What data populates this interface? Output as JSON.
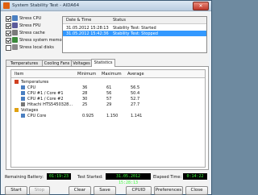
{
  "window": {
    "title": "System Stability Test - AIDA64",
    "close_glyph": "✕"
  },
  "stress": [
    {
      "label": "Stress CPU",
      "checked": true,
      "icon": "cpu-icon",
      "color": "#4a7fc1"
    },
    {
      "label": "Stress FPU",
      "checked": true,
      "icon": "fpu-icon",
      "color": "#5a5a9a"
    },
    {
      "label": "Stress cache",
      "checked": true,
      "icon": "cache-icon",
      "color": "#7a7a7a"
    },
    {
      "label": "Stress system memory",
      "checked": true,
      "icon": "memory-icon",
      "color": "#3a8a3a"
    },
    {
      "label": "Stress local disks",
      "checked": false,
      "icon": "disk-icon",
      "color": "#8a8a8a"
    }
  ],
  "log": {
    "col_date": "Date & Time",
    "col_status": "Status",
    "rows": [
      {
        "date": "31.05.2012 15:28:13",
        "status": "Stability Test: Started"
      },
      {
        "date": "31.05.2012 15:42:36",
        "status": "Stability Test: Stopped"
      }
    ]
  },
  "tabs": [
    "Temperatures",
    "Cooling Fans",
    "Voltages",
    "Statistics"
  ],
  "stats": {
    "col_item": "Item",
    "col_min": "Minimum",
    "col_max": "Maximum",
    "col_avg": "Average",
    "rows": [
      {
        "indent": 0,
        "kind": "group",
        "icon": "temperature-icon",
        "item": "Temperatures",
        "min": "",
        "max": "",
        "avg": ""
      },
      {
        "indent": 1,
        "kind": "item",
        "icon": "cpu-icon",
        "item": "CPU",
        "min": "36",
        "max": "61",
        "avg": "56.5"
      },
      {
        "indent": 1,
        "kind": "item",
        "icon": "cpu-icon",
        "item": "CPU #1 / Core #1",
        "min": "28",
        "max": "56",
        "avg": "50.4"
      },
      {
        "indent": 1,
        "kind": "item",
        "icon": "cpu-icon",
        "item": "CPU #1 / Core #2",
        "min": "30",
        "max": "57",
        "avg": "52.7"
      },
      {
        "indent": 1,
        "kind": "item",
        "icon": "disk-icon",
        "item": "Hitachi HTS5450328...",
        "min": "25",
        "max": "29",
        "avg": "27.7"
      },
      {
        "indent": 0,
        "kind": "group",
        "icon": "voltage-icon",
        "item": "Voltages",
        "min": "",
        "max": "",
        "avg": ""
      },
      {
        "indent": 1,
        "kind": "item",
        "icon": "cpu-icon",
        "item": "CPU Core",
        "min": "0.925",
        "max": "1.150",
        "avg": "1.141"
      }
    ]
  },
  "status": {
    "battery_label": "Remaining Battery:",
    "battery_value": "01:19:23",
    "started_label": "Test Started:",
    "started_value": "31.05.2012 15:28:13",
    "elapsed_label": "Elapsed Time:",
    "elapsed_value": "0:14:22"
  },
  "buttons": {
    "start": "Start",
    "stop": "Stop",
    "clear": "Clear",
    "save": "Save",
    "cpuid": "CPUID",
    "preferences": "Preferences",
    "close": "Close"
  }
}
